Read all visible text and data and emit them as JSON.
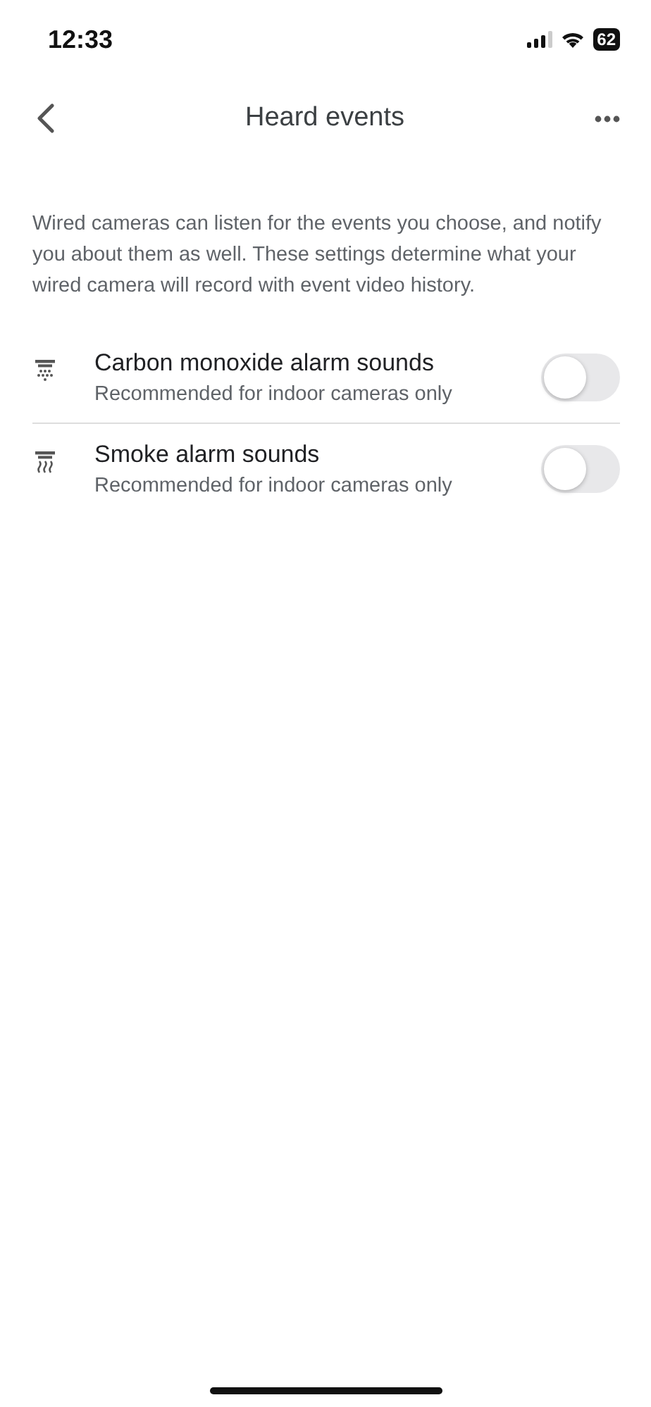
{
  "status_bar": {
    "time": "12:33",
    "battery": "62"
  },
  "header": {
    "title": "Heard events"
  },
  "description": "Wired cameras can listen for the events you choose, and notify you about them as well. These settings determine what your wired camera will record with event video history.",
  "settings": [
    {
      "kind": "co",
      "title": "Carbon monoxide alarm sounds",
      "subtitle": "Recommended for indoor cameras only",
      "on": false
    },
    {
      "kind": "smoke",
      "title": "Smoke alarm sounds",
      "subtitle": "Recommended for indoor cameras only",
      "on": false
    }
  ]
}
